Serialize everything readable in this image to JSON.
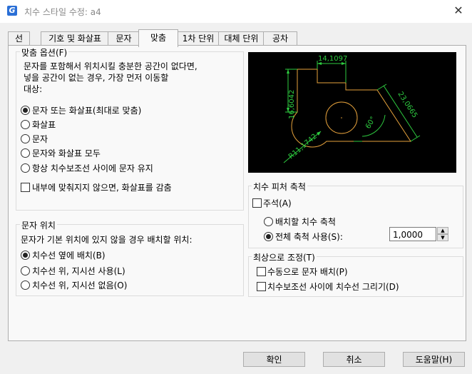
{
  "window": {
    "title": "치수 스타일 수정: a4",
    "app_icon": "G",
    "close_glyph": "✕"
  },
  "tabs": [
    "선",
    "기호 및 화살표",
    "문자",
    "맞춤",
    "1차 단위",
    "대체 단위",
    "공차"
  ],
  "fit_options": {
    "legend": "맞춤 옵션(F)",
    "description": [
      "문자를 포함해서 위치시킬 충분한 공간이 없다면,",
      "넣을 공간이 없는 경우, 가장 먼저 이동할",
      "대상:"
    ],
    "radios": [
      "문자 또는 화살표(최대로 맞춤)",
      "화살표",
      "문자",
      "문자와 화살표 모두",
      "항상 치수보조선 사이에 문자 유지"
    ],
    "selected": 0,
    "suppress_label": "내부에 맞춰지지 않으면, 화살표를 감춤"
  },
  "text_placement": {
    "legend": "문자 위치",
    "description": "문자가 기본 위치에 있지 않을 경우 배치할 위치:",
    "radios": [
      "치수선 옆에 배치(B)",
      "치수선 위, 지시선 사용(L)",
      "치수선 위, 지시선 없음(O)"
    ],
    "selected": 0
  },
  "preview": {
    "dim_top": "14,1097",
    "dim_left": "16,6042",
    "dim_angled": "23,0665",
    "angle": "60°",
    "radius": "R11,1742",
    "dim_color": "#2ecc40",
    "geom_color": "#e6a23c"
  },
  "scale": {
    "legend": "치수 피처 축척",
    "annotative": "주석(A)",
    "radio_layout": "배치할 치수 축척",
    "radio_overall": "전체 축척 사용(S):",
    "overall_value": "1,0000",
    "spin_up": "▲",
    "spin_down": "▼"
  },
  "fine_tuning": {
    "legend": "최상으로 조정(T)",
    "manual": "수동으로 문자 배치(P)",
    "draw_dimline": "치수보조선 사이에 치수선 그리기(D)"
  },
  "buttons": {
    "ok": "확인",
    "cancel": "취소",
    "help": "도움말(H)"
  }
}
